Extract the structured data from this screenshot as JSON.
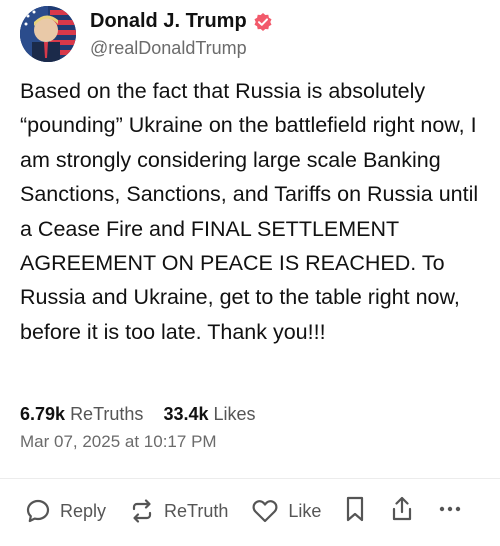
{
  "author": {
    "display_name": "Donald J. Trump",
    "handle": "@realDonaldTrump",
    "avatar_icon": "profile-avatar",
    "verified_icon": "verified-badge-icon",
    "verified_color": "#f25a6b"
  },
  "post": {
    "text": "Based on the fact that Russia is absolutely “pounding” Ukraine on the battlefield right now, I am strongly considering large scale Banking Sanctions, Sanctions, and Tariffs on Russia until a Cease Fire and FINAL SETTLEMENT AGREEMENT ON PEACE IS REACHED. To Russia and Ukraine, get to the table right now, before it is too late. Thank you!!!"
  },
  "stats": {
    "retruths_count": "6.79k",
    "retruths_label": "ReTruths",
    "likes_count": "33.4k",
    "likes_label": "Likes"
  },
  "timestamp": "Mar 07, 2025 at 10:17 PM",
  "actions": {
    "reply_label": "Reply",
    "retruth_label": "ReTruth",
    "like_label": "Like",
    "icons": [
      "reply-icon",
      "retruth-icon",
      "like-icon",
      "bookmark-icon",
      "share-icon",
      "more-icon"
    ]
  }
}
